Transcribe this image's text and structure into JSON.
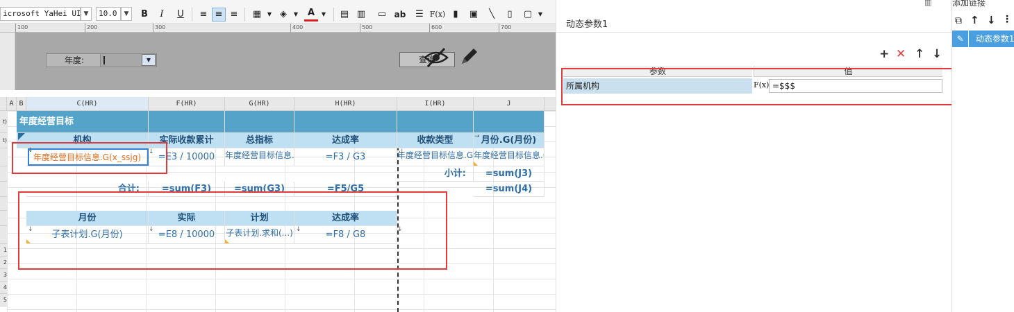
{
  "toolbar": {
    "font_family": "icrosoft YaHei UI",
    "font_size": "10.0",
    "bold": "B",
    "italic": "I",
    "underline": "U",
    "text_label": "ab",
    "formula_label": "F(x)"
  },
  "ruler": {
    "ticks": [
      "100",
      "200",
      "300",
      "400",
      "500",
      "600",
      "700"
    ]
  },
  "param_pane": {
    "year_label": "年度:",
    "query_button": "查询"
  },
  "grid": {
    "col_headers": [
      "A",
      "B",
      "C(HR)",
      "F(HR)",
      "G(HR)",
      "H(HR)",
      "I(HR)",
      "J"
    ],
    "row_headers": [
      "t)",
      "t)",
      "",
      "",
      "",
      "",
      "",
      "",
      "1",
      "2",
      "3",
      "4",
      "5"
    ],
    "band_title": "年度经营目标",
    "header_row": [
      "机构",
      "实际收款累计",
      "总指标",
      "达成率",
      "收款类型",
      "月份.G(月份)"
    ],
    "data_row": [
      "年度经营目标信息.G(x_ssjg)",
      "=E3 / 10000",
      "年度经营目标信息.G(...)",
      "=F3 / G3",
      "年度经营目标信息.G(...)",
      "年度经营目标信息.G(...)"
    ],
    "subtotal_label": "小计:",
    "subtotal_value": "=sum(J3)",
    "total_label": "合计:",
    "total_row": [
      "=sum(F3)",
      "=sum(G3)",
      "=F5/G5"
    ],
    "total_j": "=sum(J4)",
    "sub_header": [
      "月份",
      "实际",
      "计划",
      "达成率"
    ],
    "sub_data": [
      "子表计划.G(月份)",
      "=E8 / 10000",
      "子表计划.求和(...)",
      "=F8 / G8"
    ]
  },
  "right_panel": {
    "title": "动态参数1",
    "tools": [
      "+",
      "✕",
      "↑",
      "↓"
    ],
    "col_param": "参数",
    "col_value": "值",
    "param_name": "所属机构",
    "fx_label": "F(x)",
    "param_value": "=$$$"
  },
  "far_panel": {
    "tab_label": "添加链接",
    "item": "动态参数1"
  },
  "colors": {
    "band": "#55a3c9",
    "header": "#bfe0f2",
    "highlight": "#e03a3a",
    "selection": "#4a9fe0"
  }
}
